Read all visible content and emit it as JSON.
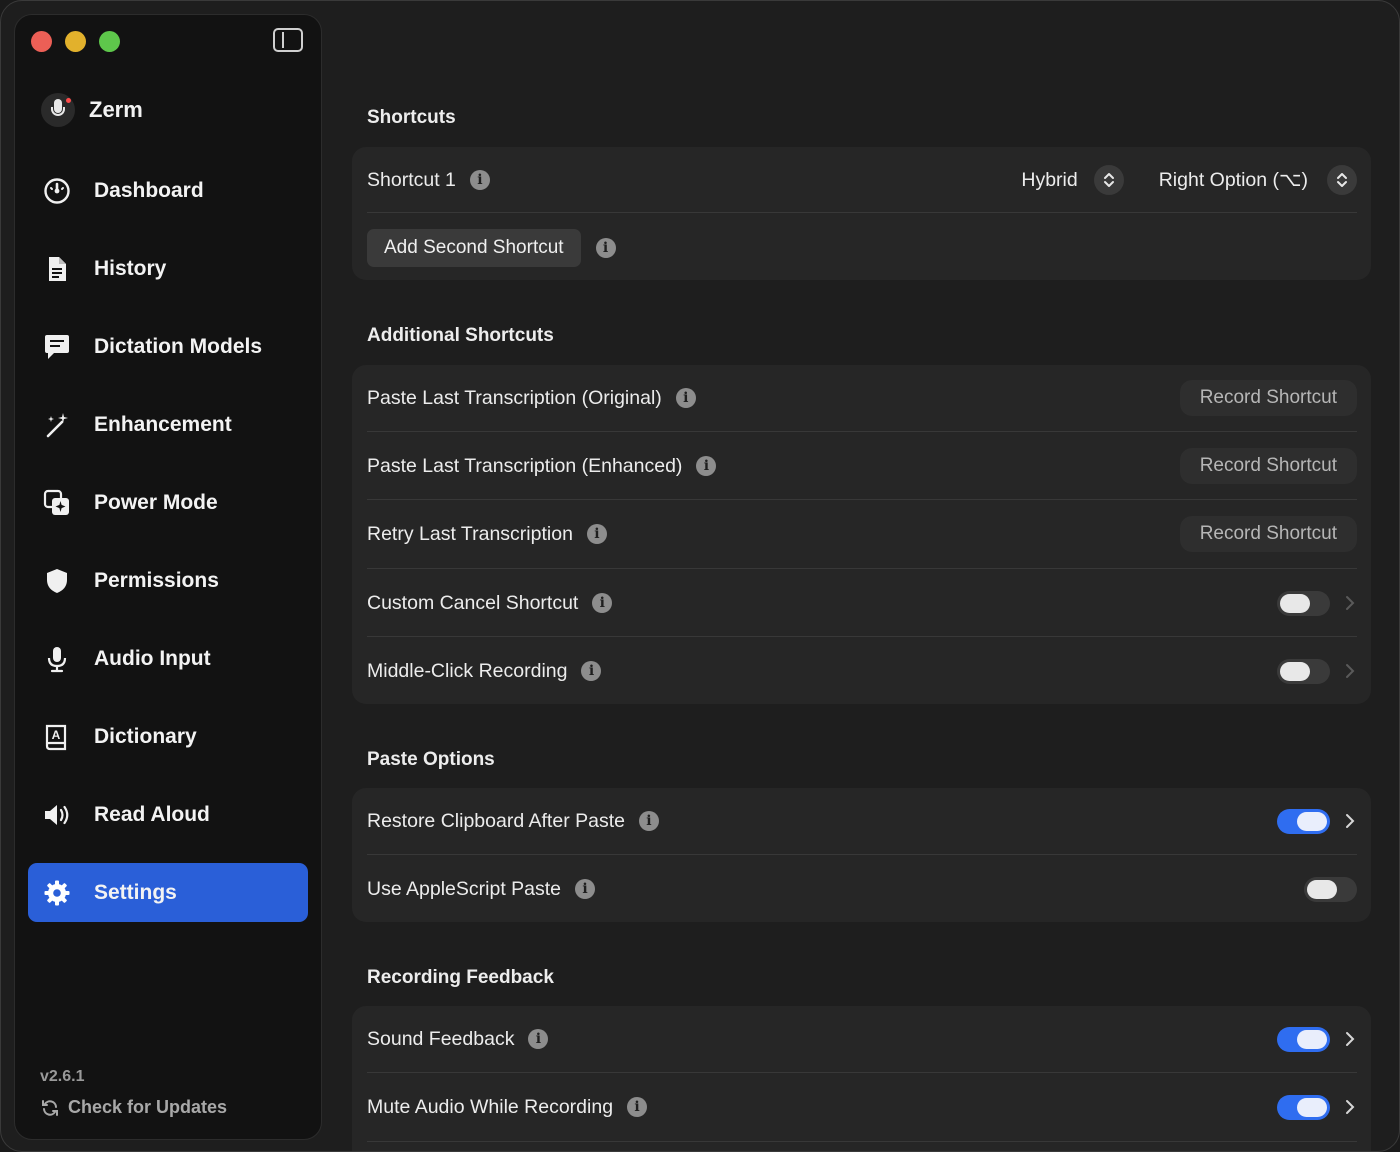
{
  "app": {
    "name": "Zerm"
  },
  "sidebar": {
    "items": [
      {
        "label": "Dashboard",
        "icon": "gauge-icon"
      },
      {
        "label": "History",
        "icon": "document-icon"
      },
      {
        "label": "Dictation Models",
        "icon": "chat-bubble-icon"
      },
      {
        "label": "Enhancement",
        "icon": "magic-wand-icon"
      },
      {
        "label": "Power Mode",
        "icon": "power-mode-icon"
      },
      {
        "label": "Permissions",
        "icon": "shield-icon"
      },
      {
        "label": "Audio Input",
        "icon": "microphone-icon"
      },
      {
        "label": "Dictionary",
        "icon": "dictionary-book-icon"
      },
      {
        "label": "Read Aloud",
        "icon": "speaker-icon"
      },
      {
        "label": "Settings",
        "icon": "gear-icon",
        "active": true
      }
    ],
    "version": "v2.6.1",
    "check_updates": "Check for Updates"
  },
  "colors": {
    "accent": "#2a5fd8",
    "toggle_on": "#2f6df0",
    "background": "#1e1e1e",
    "card": "#262626"
  },
  "shortcuts": {
    "title": "Shortcuts",
    "shortcut1_label": "Shortcut 1",
    "mode_value": "Hybrid",
    "key_value": "Right Option (⌥)",
    "add_second_label": "Add Second Shortcut"
  },
  "additional": {
    "title": "Additional Shortcuts",
    "rows": [
      {
        "label": "Paste Last Transcription (Original)",
        "button": "Record Shortcut"
      },
      {
        "label": "Paste Last Transcription (Enhanced)",
        "button": "Record Shortcut"
      },
      {
        "label": "Retry Last Transcription",
        "button": "Record Shortcut"
      },
      {
        "label": "Custom Cancel Shortcut",
        "toggle": false
      },
      {
        "label": "Middle-Click Recording",
        "toggle": false
      }
    ]
  },
  "paste": {
    "title": "Paste Options",
    "rows": [
      {
        "label": "Restore Clipboard After Paste",
        "toggle": true
      },
      {
        "label": "Use AppleScript Paste",
        "toggle": false
      }
    ]
  },
  "feedback": {
    "title": "Recording Feedback",
    "rows": [
      {
        "label": "Sound Feedback",
        "toggle": true
      },
      {
        "label": "Mute Audio While Recording",
        "toggle": true
      }
    ]
  }
}
